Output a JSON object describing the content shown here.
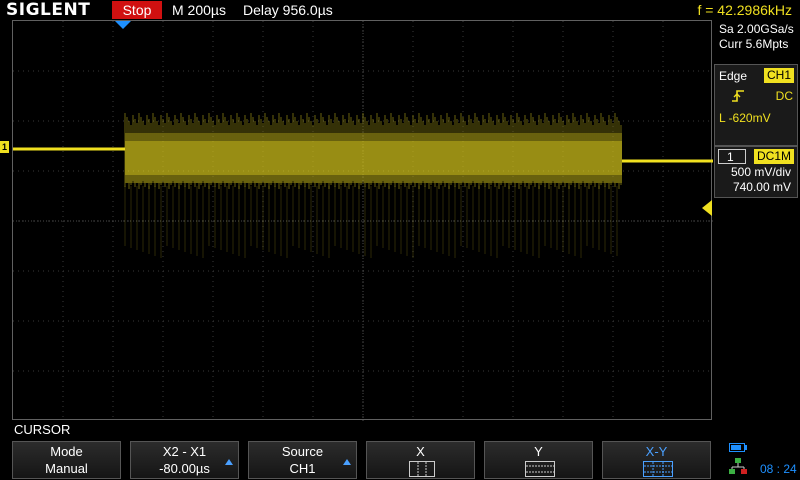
{
  "header": {
    "brand": "SIGLENT",
    "run_state": "Stop",
    "timebase": "M 200µs",
    "delay": "Delay 956.0µs",
    "frequency": "f = 42.2986kHz"
  },
  "acquisition": {
    "sample_rate": "Sa 2.00GSa/s",
    "memory_depth": "Curr 5.6Mpts"
  },
  "trigger": {
    "type": "Edge",
    "source": "CH1",
    "slope_icon": "rising-edge-icon",
    "coupling": "DC",
    "level": "L  -620mV"
  },
  "channel": {
    "number": "1",
    "coupling": "DC1M",
    "scale": "500 mV/div",
    "offset": "740.00 mV",
    "marker_label": "1",
    "color": "#f0e020"
  },
  "waveform": {
    "burst_start_fraction": 0.16,
    "burst_end_fraction": 0.87
  },
  "menu": {
    "title": "CURSOR",
    "softkeys": [
      {
        "label": "Mode",
        "value": "Manual"
      },
      {
        "label": "X2 - X1",
        "value": "-80.00µs"
      },
      {
        "label": "Source",
        "value": "CH1"
      },
      {
        "label": "X",
        "value": "",
        "icon": "x-cursor-icon"
      },
      {
        "label": "Y",
        "value": "",
        "icon": "y-cursor-icon"
      },
      {
        "label": "X-Y",
        "value": "",
        "icon": "xy-cursor-icon"
      }
    ]
  },
  "status": {
    "time": "08 : 24",
    "accent_color": "#1e90ff"
  }
}
